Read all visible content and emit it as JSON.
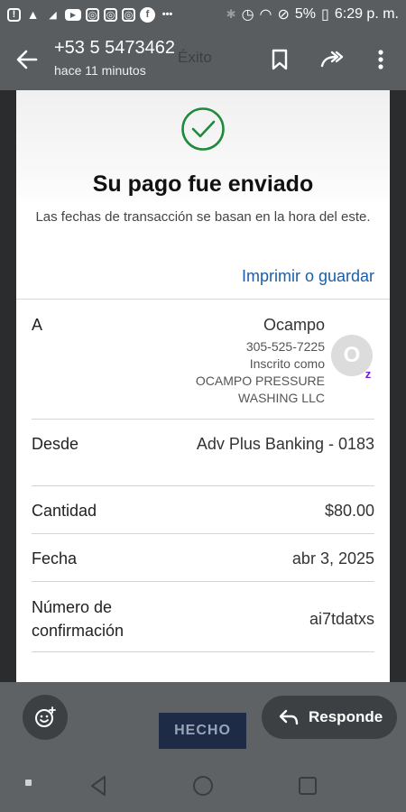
{
  "status_bar": {
    "battery": "5%",
    "time": "6:29 p. m."
  },
  "app_bar": {
    "contact_number": "+53 5 5473462",
    "contact_subtitle": "hace 11 minutos",
    "message_status": "Éxito"
  },
  "payment": {
    "headline": "Su pago fue enviado",
    "note": "Las fechas de transacción se basan en la hora del este.",
    "print_link": "Imprimir o guardar",
    "to": {
      "label": "A",
      "name": "Ocampo",
      "phone": "305-525-7225",
      "enrolled_label": "Inscrito como",
      "business_line1": "OCAMPO PRESSURE",
      "business_line2": "WASHING LLC",
      "avatar_initial": "O",
      "badge": "z"
    },
    "from": {
      "label": "Desde",
      "value": "Adv Plus Banking - 0183"
    },
    "amount": {
      "label": "Cantidad",
      "value": "$80.00"
    },
    "date": {
      "label": "Fecha",
      "value": "abr 3, 2025"
    },
    "confirmation": {
      "label_line1": "Número de",
      "label_line2": "confirmación",
      "value": "ai7tdatxs"
    }
  },
  "actions": {
    "done_label": "HECHO",
    "reply_label": "Responde"
  },
  "colors": {
    "check_green": "#1f8a3c",
    "link_blue": "#1a5fa8",
    "done_button": "#1e2b47",
    "zelle_purple": "#6d1ed4"
  }
}
